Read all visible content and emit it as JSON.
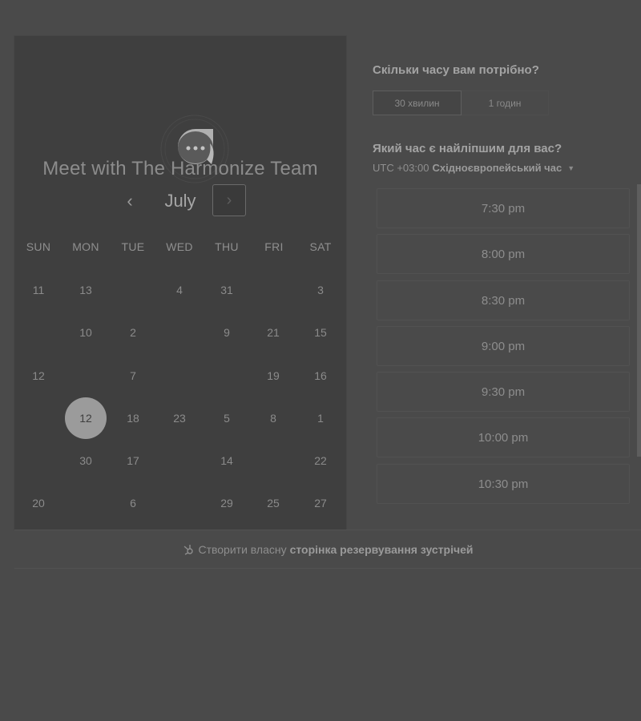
{
  "calendar": {
    "team_title": "Meet with The Harmonize Team",
    "month": "July",
    "prev_icon": "‹",
    "next_icon": "›",
    "weekdays": [
      "SUN",
      "MON",
      "TUE",
      "WED",
      "THU",
      "FRI",
      "SAT"
    ],
    "days": [
      {
        "label": "11",
        "row": 0,
        "col": 0
      },
      {
        "label": "13",
        "row": 0,
        "col": 1
      },
      {
        "label": "4",
        "row": 0,
        "col": 3
      },
      {
        "label": "31",
        "row": 0,
        "col": 4
      },
      {
        "label": "3",
        "row": 0,
        "col": 6
      },
      {
        "label": "10",
        "row": 1,
        "col": 1
      },
      {
        "label": "2",
        "row": 1,
        "col": 2
      },
      {
        "label": "9",
        "row": 1,
        "col": 4
      },
      {
        "label": "21",
        "row": 1,
        "col": 5
      },
      {
        "label": "15",
        "row": 1,
        "col": 6
      },
      {
        "label": "12",
        "row": 2,
        "col": 0
      },
      {
        "label": "7",
        "row": 2,
        "col": 2
      },
      {
        "label": "19",
        "row": 2,
        "col": 5
      },
      {
        "label": "16",
        "row": 2,
        "col": 6
      },
      {
        "label": "12",
        "row": 3,
        "col": 1,
        "selected": true
      },
      {
        "label": "18",
        "row": 3,
        "col": 2
      },
      {
        "label": "23",
        "row": 3,
        "col": 3
      },
      {
        "label": "5",
        "row": 3,
        "col": 4
      },
      {
        "label": "8",
        "row": 3,
        "col": 5
      },
      {
        "label": "1",
        "row": 3,
        "col": 6
      },
      {
        "label": "30",
        "row": 4,
        "col": 1
      },
      {
        "label": "17",
        "row": 4,
        "col": 2
      },
      {
        "label": "14",
        "row": 4,
        "col": 4
      },
      {
        "label": "22",
        "row": 4,
        "col": 6
      },
      {
        "label": "20",
        "row": 5,
        "col": 0
      },
      {
        "label": "6",
        "row": 5,
        "col": 2
      },
      {
        "label": "29",
        "row": 5,
        "col": 4
      },
      {
        "label": "25",
        "row": 5,
        "col": 5
      },
      {
        "label": "27",
        "row": 5,
        "col": 6
      }
    ]
  },
  "booking": {
    "duration_question": "Скільки часу вам потрібно?",
    "durations": [
      "30 хвилин",
      "1 годин"
    ],
    "time_question": "Який час є найліпшим для вас?",
    "tz_offset": "UTC +03:00",
    "tz_name": "Східноєвропейський час",
    "tz_caret": "▼",
    "slots": [
      "7:30 pm",
      "8:00 pm",
      "8:30 pm",
      "9:00 pm",
      "9:30 pm",
      "10:00 pm",
      "10:30 pm"
    ]
  },
  "footer": {
    "prefix": "Створити власну",
    "link": "сторінка резервування зустрічей"
  }
}
